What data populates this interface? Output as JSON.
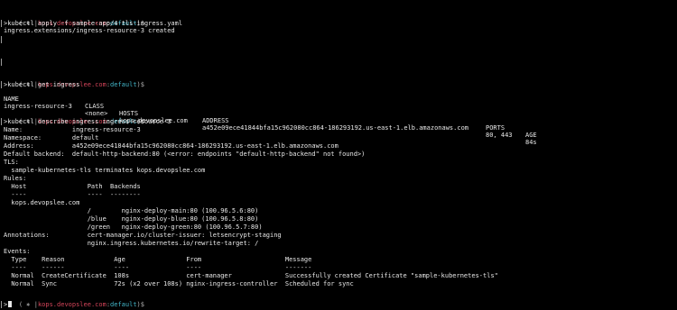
{
  "theme": {
    "background": "#000000",
    "foreground": "#e8e8e8",
    "host_color": "#d6455a",
    "namespace_color": "#43b6c9"
  },
  "prompt": {
    "open": "(",
    "glyph": "⎈",
    "sep": "|",
    "host": "kops.devopslee.com",
    "colon": ":",
    "namespace": "default",
    "close": ")$"
  },
  "block1": {
    "command": ">kubectl apply -f sample-app/4-tls-ingress.yaml",
    "output": "ingress.extensions/ingress-resource-3 created"
  },
  "block2": {
    "command": ">kubectl get ingress",
    "headers": [
      "NAME",
      "CLASS",
      "HOSTS",
      "ADDRESS",
      "PORTS",
      "AGE"
    ],
    "row": [
      "ingress-resource-3",
      "<none>",
      "kops.devopslee.com",
      "a452e09ece41844bfa15c962080cc864-186293192.us-east-1.elb.amazonaws.com",
      "80, 443",
      "84s"
    ]
  },
  "block3": {
    "command": ">kubectl describe ingress ingress-resource-3",
    "lines": [
      "Name:             ingress-resource-3",
      "Namespace:        default",
      "Address:          a452e09ece41844bfa15c962080cc864-186293192.us-east-1.elb.amazonaws.com",
      "Default backend:  default-http-backend:80 (<error: endpoints \"default-http-backend\" not found>)",
      "TLS:",
      "  sample-kubernetes-tls terminates kops.devopslee.com",
      "Rules:",
      "  Host                Path  Backends",
      "  ----                ----  --------",
      "  kops.devopslee.com",
      "                      /        nginx-deploy-main:80 (100.96.5.6:80)",
      "                      /blue    nginx-deploy-blue:80 (100.96.5.8:80)",
      "                      /green   nginx-deploy-green:80 (100.96.5.7:80)",
      "Annotations:          cert-manager.io/cluster-issuer: letsencrypt-staging",
      "                      nginx.ingress.kubernetes.io/rewrite-target: /",
      "Events:",
      "  Type    Reason             Age                From                      Message",
      "  ----    ------             ----               ----                      -------",
      "  Normal  CreateCertificate  108s               cert-manager              Successfully created Certificate \"sample-kubernetes-tls\"",
      "  Normal  Sync               72s (x2 over 108s) nginx-ingress-controller  Scheduled for sync"
    ]
  },
  "final": {
    "command": ">"
  }
}
